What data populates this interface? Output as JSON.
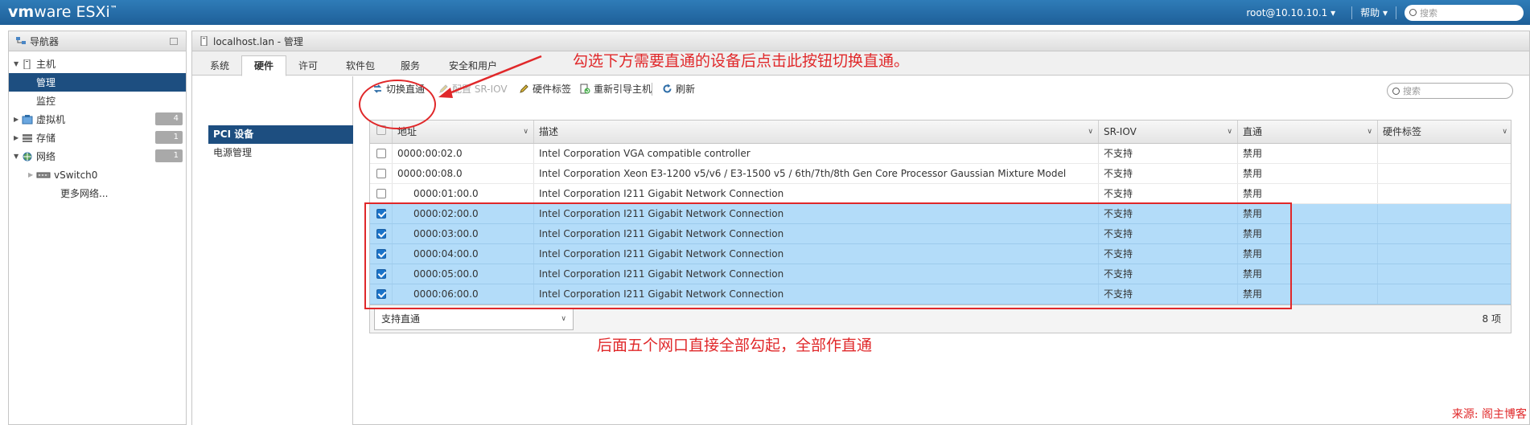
{
  "app": {
    "brand": "vm",
    "brand_mid": "ware",
    "product": "ESXi",
    "user": "root@10.10.10.1",
    "help": "帮助",
    "search_placeholder": "搜索"
  },
  "navigator": {
    "title": "导航器",
    "host": "主机",
    "manage": "管理",
    "monitor": "监控",
    "vms": {
      "label": "虚拟机",
      "count": "4"
    },
    "storage": {
      "label": "存储",
      "count": "1"
    },
    "network": {
      "label": "网络",
      "count": "1"
    },
    "vswitch": "vSwitch0",
    "more_networks": "更多网络..."
  },
  "main": {
    "title": "localhost.lan - 管理",
    "tabs": [
      "系统",
      "硬件",
      "许可",
      "软件包",
      "服务",
      "安全和用户"
    ],
    "subnav": [
      "PCI 设备",
      "电源管理"
    ],
    "toolbar": {
      "toggle_passthrough": "切换直通",
      "configure_sriov": "配置 SR-IOV",
      "hardware_label": "硬件标签",
      "reboot_host": "重新引导主机",
      "refresh": "刷新",
      "search_placeholder": "搜索"
    },
    "columns": [
      "地址",
      "描述",
      "SR-IOV",
      "直通",
      "硬件标签"
    ],
    "rows": [
      {
        "address": "0000:00:02.0",
        "desc": "Intel Corporation VGA compatible controller",
        "sriov": "不支持",
        "passthrough": "禁用",
        "label": "",
        "checked": false
      },
      {
        "address": "0000:00:08.0",
        "desc": "Intel Corporation Xeon E3-1200 v5/v6 / E3-1500 v5 / 6th/7th/8th Gen Core Processor Gaussian Mixture Model",
        "sriov": "不支持",
        "passthrough": "禁用",
        "label": "",
        "checked": false
      },
      {
        "address": "0000:01:00.0",
        "desc": "Intel Corporation I211 Gigabit Network Connection",
        "sriov": "不支持",
        "passthrough": "禁用",
        "label": "",
        "checked": false
      },
      {
        "address": "0000:02:00.0",
        "desc": "Intel Corporation I211 Gigabit Network Connection",
        "sriov": "不支持",
        "passthrough": "禁用",
        "label": "",
        "checked": true
      },
      {
        "address": "0000:03:00.0",
        "desc": "Intel Corporation I211 Gigabit Network Connection",
        "sriov": "不支持",
        "passthrough": "禁用",
        "label": "",
        "checked": true
      },
      {
        "address": "0000:04:00.0",
        "desc": "Intel Corporation I211 Gigabit Network Connection",
        "sriov": "不支持",
        "passthrough": "禁用",
        "label": "",
        "checked": true
      },
      {
        "address": "0000:05:00.0",
        "desc": "Intel Corporation I211 Gigabit Network Connection",
        "sriov": "不支持",
        "passthrough": "禁用",
        "label": "",
        "checked": true
      },
      {
        "address": "0000:06:00.0",
        "desc": "Intel Corporation I211 Gigabit Network Connection",
        "sriov": "不支持",
        "passthrough": "禁用",
        "label": "",
        "checked": true
      }
    ],
    "filter_select": "支持直通",
    "item_count": "8 项"
  },
  "annotations": {
    "top_note": "勾选下方需要直通的设备后点击此按钮切换直通。",
    "bottom_note": "后面五个网口直接全部勾起，全部作直通",
    "source": "来源: 阁主博客"
  },
  "colors": {
    "annotation": "#e0282a",
    "topbar": "#2f7cb8",
    "selected_row": "#b3dcf9",
    "nav_selected": "#1d4e80"
  }
}
